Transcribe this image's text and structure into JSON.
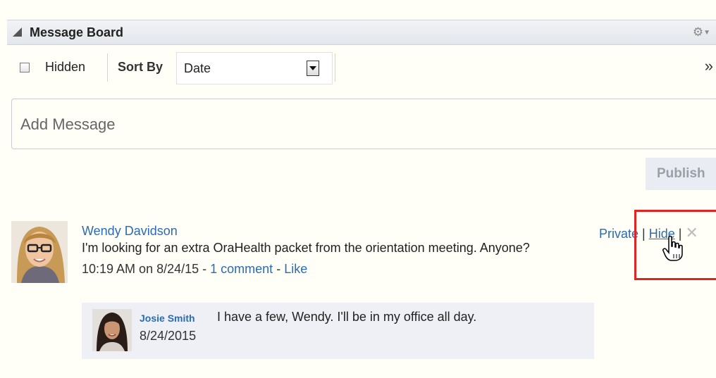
{
  "panel": {
    "title": "Message Board"
  },
  "toolbar": {
    "hidden_label": "Hidden",
    "sort_by_label": "Sort By",
    "sort_value": "Date",
    "overflow_glyph": "»"
  },
  "composer": {
    "placeholder": "Add Message",
    "publish_label": "Publish"
  },
  "message": {
    "author": "Wendy Davidson",
    "text": "I'm looking for an extra OraHealth packet from the orientation meeting. Anyone?",
    "time": "10:19 AM on 8/24/15",
    "dash1": " - ",
    "comment_link": "1 comment",
    "dash2": " - ",
    "like_link": "Like",
    "actions": {
      "private": "Private",
      "sep": " | ",
      "hide": "Hide",
      "delete_glyph": "✕"
    }
  },
  "comment": {
    "author": "Josie Smith",
    "text": "I have a few, Wendy. I'll be in my office all day.",
    "date": "8/24/2015"
  },
  "colors": {
    "link": "#2a6bb3",
    "highlight": "#e02424",
    "comment_bg": "#eef0f6"
  }
}
